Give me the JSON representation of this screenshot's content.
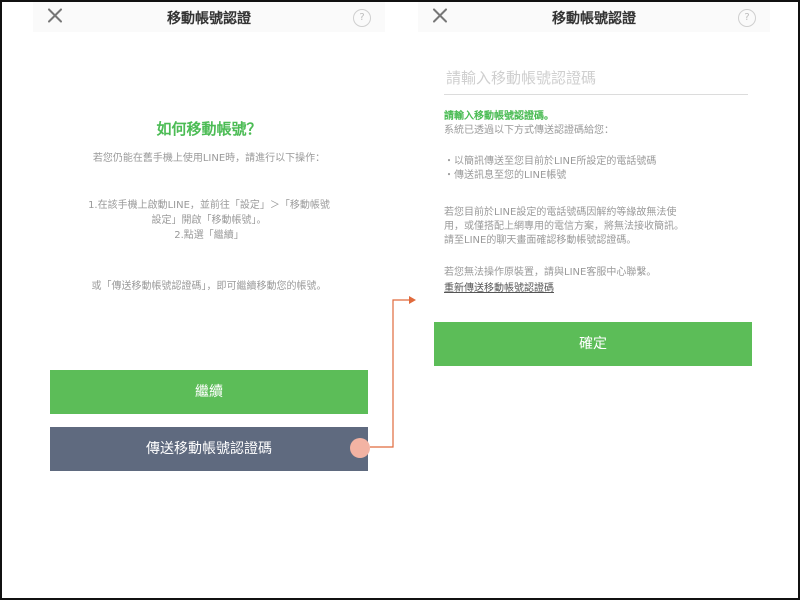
{
  "left": {
    "header_title": "移動帳號認證",
    "help": "?",
    "question": "如何移動帳號？",
    "intro": "若您仍能在舊手機上使用LINE時，請進行以下操作：",
    "step1a": "1.在該手機上啟動LINE，並前往「設定」＞「移動帳號",
    "step1b": "設定」開啟「移動帳號」。",
    "step2": "2.點選「繼續」",
    "alternative": "或「傳送移動帳號認證碼」，即可繼續移動您的帳號。",
    "continue_label": "繼續",
    "send_code_label": "傳送移動帳號認證碼"
  },
  "right": {
    "header_title": "移動帳號認證",
    "help": "?",
    "input_placeholder": "請輸入移動帳號認證碼",
    "prompt": "請輸入移動帳號認證碼。",
    "sent_info": "系統已透過以下方式傳送認證碼給您：",
    "method1": "・以簡訊傳送至您目前於LINE所設定的電話號碼",
    "method2": "・傳送訊息至您的LINE帳號",
    "note1": "若您目前於LINE設定的電話號碼因解約等緣故無法使",
    "note2": "用，或僅搭配上網專用的電信方案，將無法接收簡訊。",
    "note3": "請至LINE的聊天畫面確認移動帳號認證碼。",
    "support": "若您無法操作原裝置，請與LINE客服中心聯繫。",
    "resend_label": "重新傳送移動帳號認證碼",
    "confirm_label": "確定"
  },
  "colors": {
    "accent_green": "#5cbd58",
    "slate_button": "#5f6a7f",
    "arrow": "#e06a3c"
  }
}
